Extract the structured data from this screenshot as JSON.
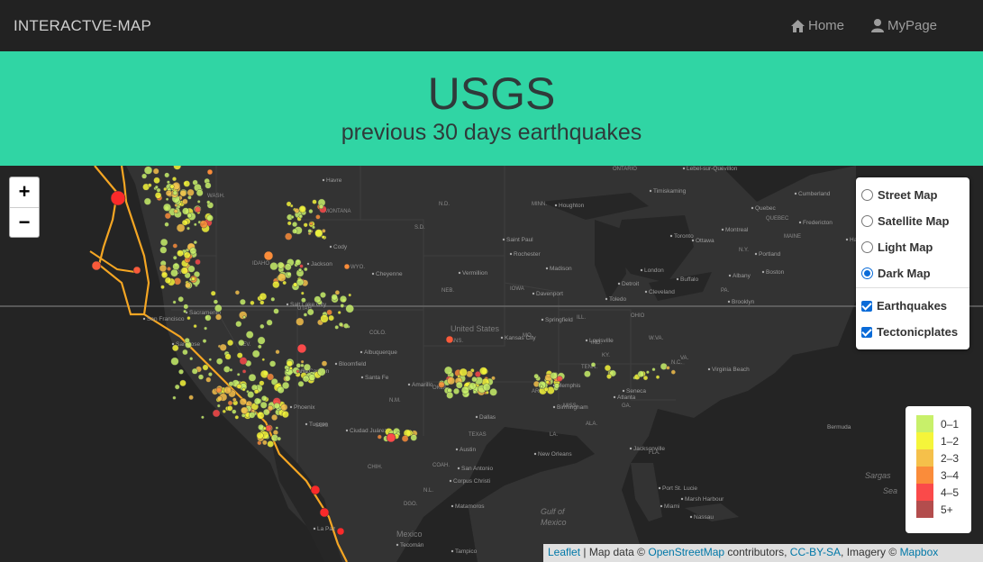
{
  "nav": {
    "brand": "INTERACTVE-MAP",
    "home_label": "Home",
    "mypage_label": "MyPage",
    "home_icon": "home-icon",
    "mypage_icon": "user-icon"
  },
  "header": {
    "title": "USGS",
    "subtitle": "previous 30 days earthquakes"
  },
  "zoom": {
    "in_label": "+",
    "out_label": "−"
  },
  "layers": {
    "base": [
      {
        "label": "Street Map",
        "checked": false
      },
      {
        "label": "Satellite Map",
        "checked": false
      },
      {
        "label": "Light Map",
        "checked": false
      },
      {
        "label": "Dark Map",
        "checked": true
      }
    ],
    "overlays": [
      {
        "label": "Earthquakes",
        "checked": true
      },
      {
        "label": "Tectonicplates",
        "checked": true
      }
    ]
  },
  "legend": {
    "items": [
      {
        "label": "0–1",
        "color": "#b7f34d"
      },
      {
        "label": "1–2",
        "color": "#e1f34d"
      },
      {
        "label": "2–3",
        "color": "#f3db4d"
      },
      {
        "label": "3–4",
        "color": "#f3ba4d"
      },
      {
        "label": "4–5",
        "color": "#f0a76b"
      },
      {
        "label": "5+",
        "color": "#f06b6b"
      }
    ]
  },
  "attribution": {
    "leaflet": "Leaflet",
    "map_data": " | Map data © ",
    "osm": "OpenStreetMap",
    "contributors": " contributors, ",
    "license": "CC-BY-SA",
    "imagery": ", Imagery © ",
    "mapbox": "Mapbox"
  },
  "map_labels": {
    "country": "United States",
    "mexico": "Mexico",
    "gulf1": "Gulf of",
    "gulf2": "Mexico",
    "sargasso1": "Sargas",
    "sargasso2": "Sea",
    "bermuda": "Bermuda",
    "states": [
      "WASH.",
      "MONTANA",
      "N.D.",
      "MINN.",
      "WYO.",
      "S.D.",
      "IOWA",
      "NEB.",
      "COLO.",
      "KANS.",
      "MO.",
      "ILL.",
      "IND.",
      "OHIO",
      "KY.",
      "TENN.",
      "ARK.",
      "MISS.",
      "ALA.",
      "GA.",
      "N.M.",
      "OKLA.",
      "TEXAS",
      "LA.",
      "N.C.",
      "W.VA.",
      "VA.",
      "PA.",
      "N.Y.",
      "MAINE",
      "ONTARIO",
      "QUEBEC",
      "ARIZ.",
      "NEV.",
      "UTAH",
      "IDAHO",
      "ORE.",
      "CHIH.",
      "SON.",
      "DGO.",
      "COAH.",
      "N.L.",
      "FLA."
    ],
    "cities": [
      "Havre",
      "Cody",
      "Jackson",
      "Cheyenne",
      "Salt Lake City",
      "Grand Canyon",
      "Phoenix",
      "Tucson",
      "Ciudad Juárez",
      "Albuquerque",
      "Santa Fe",
      "Bloomfield",
      "Amarillo",
      "Dallas",
      "Austin",
      "San Antonio",
      "Corpus Christi",
      "Matamoros",
      "Tampico",
      "Tecomán",
      "La Paz",
      "New Orleans",
      "Jacksonville",
      "Miami",
      "Nassau",
      "Marsh Harbour",
      "Port St. Lucie",
      "Memphis",
      "Louisville",
      "Kansas City",
      "Springfield",
      "Birmingham",
      "Atlanta",
      "Seneca",
      "Virginia Beach",
      "Cleveland",
      "Toledo",
      "Detroit",
      "Toronto",
      "Buffalo",
      "Albany",
      "Brooklyn",
      "Boston",
      "Portland",
      "Montreal",
      "Ottawa",
      "Quebec",
      "Cumberland",
      "Fredericton",
      "Halifax",
      "Timiskaming",
      "Houghton",
      "Saint Paul",
      "Rochester",
      "Madison",
      "Davenport",
      "Vermillion",
      "London",
      "Lebel-sur-Quévillon",
      "San Francisco",
      "Sacramento",
      "San Jose"
    ]
  }
}
